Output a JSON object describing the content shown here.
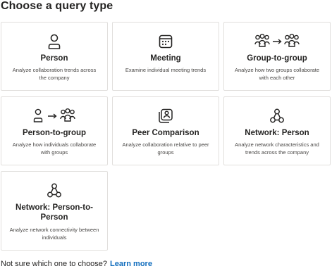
{
  "heading": "Choose a query type",
  "cards": [
    {
      "title": "Person",
      "desc": "Analyze collaboration trends across the company",
      "icon": "person-icon"
    },
    {
      "title": "Meeting",
      "desc": "Examine individual meeting trends",
      "icon": "calendar-icon"
    },
    {
      "title": "Group-to-group",
      "desc": "Analyze how two groups collaborate with each other",
      "icon": "group-to-group-icon"
    },
    {
      "title": "Person-to-group",
      "desc": "Analyze how individuals collaborate with groups",
      "icon": "person-to-group-icon"
    },
    {
      "title": "Peer Comparison",
      "desc": "Analyze collaboration relative to peer groups",
      "icon": "peer-comparison-icon"
    },
    {
      "title": "Network: Person",
      "desc": "Analyze network characteristics and trends across the company",
      "icon": "network-icon"
    },
    {
      "title": "Network: Person-to-Person",
      "desc": "Analyze network connectivity between individuals",
      "icon": "network-icon"
    }
  ],
  "footer": {
    "question": "Not sure which one to choose?",
    "link": "Learn more"
  },
  "colors": {
    "link": "#0f6cbd",
    "border": "#e1dfdd",
    "text": "#252423"
  }
}
